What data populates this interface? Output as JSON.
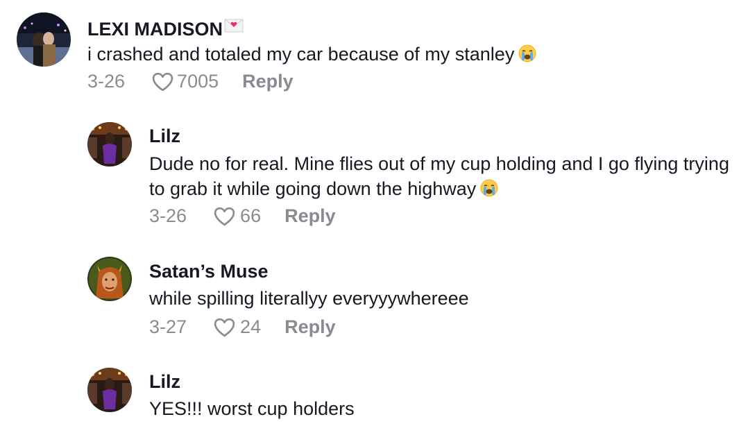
{
  "comments": [
    {
      "username": "LEXI MADISON",
      "text": "i crashed and totaled my car because of my stanley",
      "emoji": "loudly-crying-face",
      "date": "3-26",
      "likes": "7005",
      "reply_label": "Reply"
    },
    {
      "username": "Lilz",
      "text": "Dude no for real. Mine flies out of my cup holding and I go flying trying to grab it while going down the highway",
      "emoji": "loudly-crying-face",
      "date": "3-26",
      "likes": "66",
      "reply_label": "Reply"
    },
    {
      "username": "Satan’s Muse",
      "text": "while spilling literallyy everyyywhereee",
      "date": "3-27",
      "likes": "24",
      "reply_label": "Reply"
    },
    {
      "username": "Lilz",
      "text": "YES!!! worst cup holders"
    }
  ],
  "colors": {
    "text_primary": "#161823",
    "text_secondary": "#8a8b91",
    "background": "#ffffff"
  },
  "icons": {
    "like": "heart-outline-icon",
    "username_badge": "love-letter-icon",
    "emoji": "loudly-crying-face"
  }
}
